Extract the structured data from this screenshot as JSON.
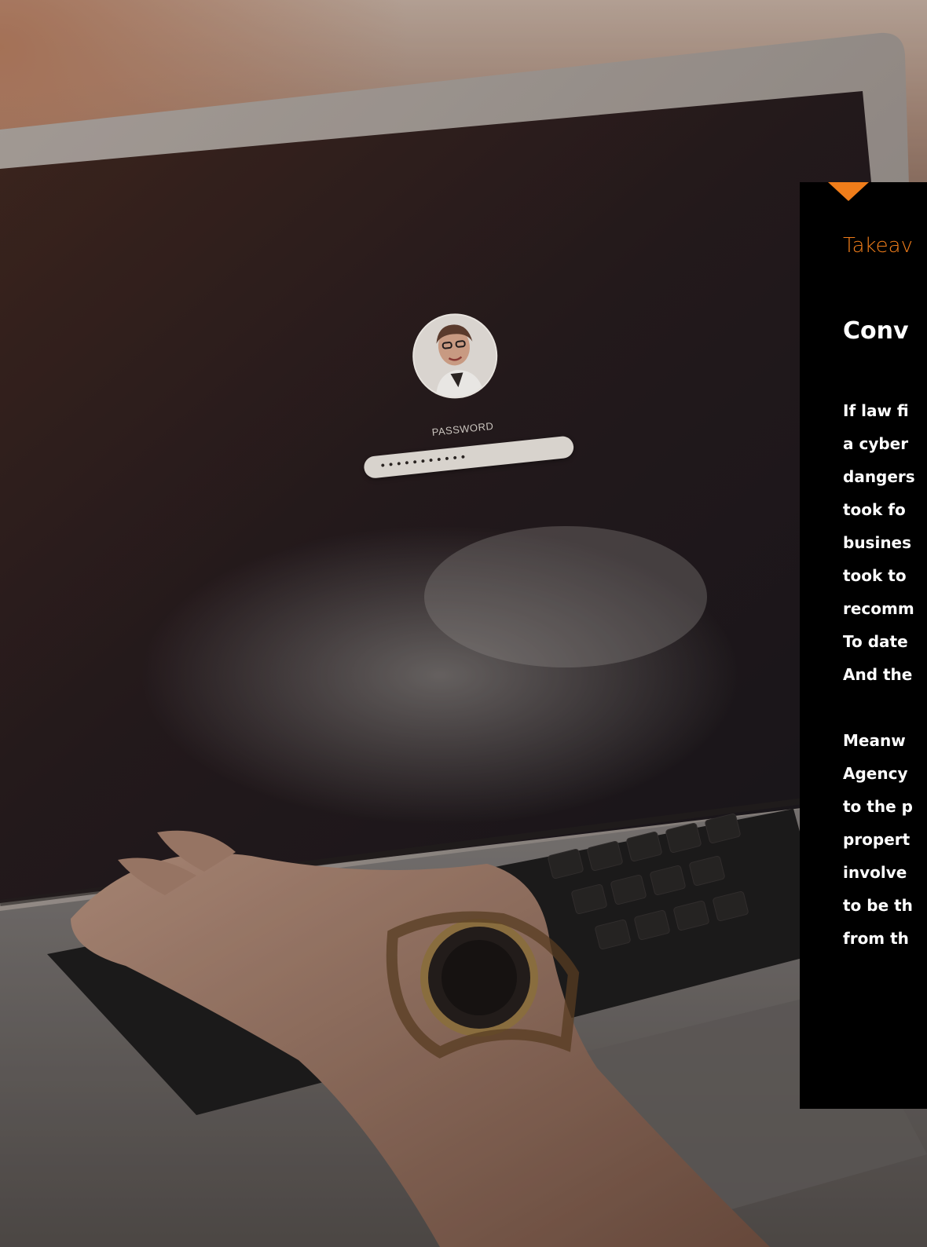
{
  "login_screen": {
    "password_label": "PASSWORD",
    "password_mask": "•••••••••••"
  },
  "takeaway": {
    "eyebrow": "Takeav",
    "heading": "Conv",
    "paragraph_1": [
      "If law fi",
      "a cyber",
      "dangers",
      "took fo",
      "busines",
      "took to",
      "recomm",
      "To date",
      "And the"
    ],
    "paragraph_2": [
      "Meanw",
      "Agency",
      "to the p",
      "propert",
      "involve",
      "to be th",
      "from th"
    ]
  },
  "colors": {
    "accent": "#f07d1a",
    "panel_bg": "#000000",
    "panel_text": "#ffffff"
  },
  "icons": {
    "notch": "triangle-down-icon",
    "avatar": "user-avatar"
  }
}
